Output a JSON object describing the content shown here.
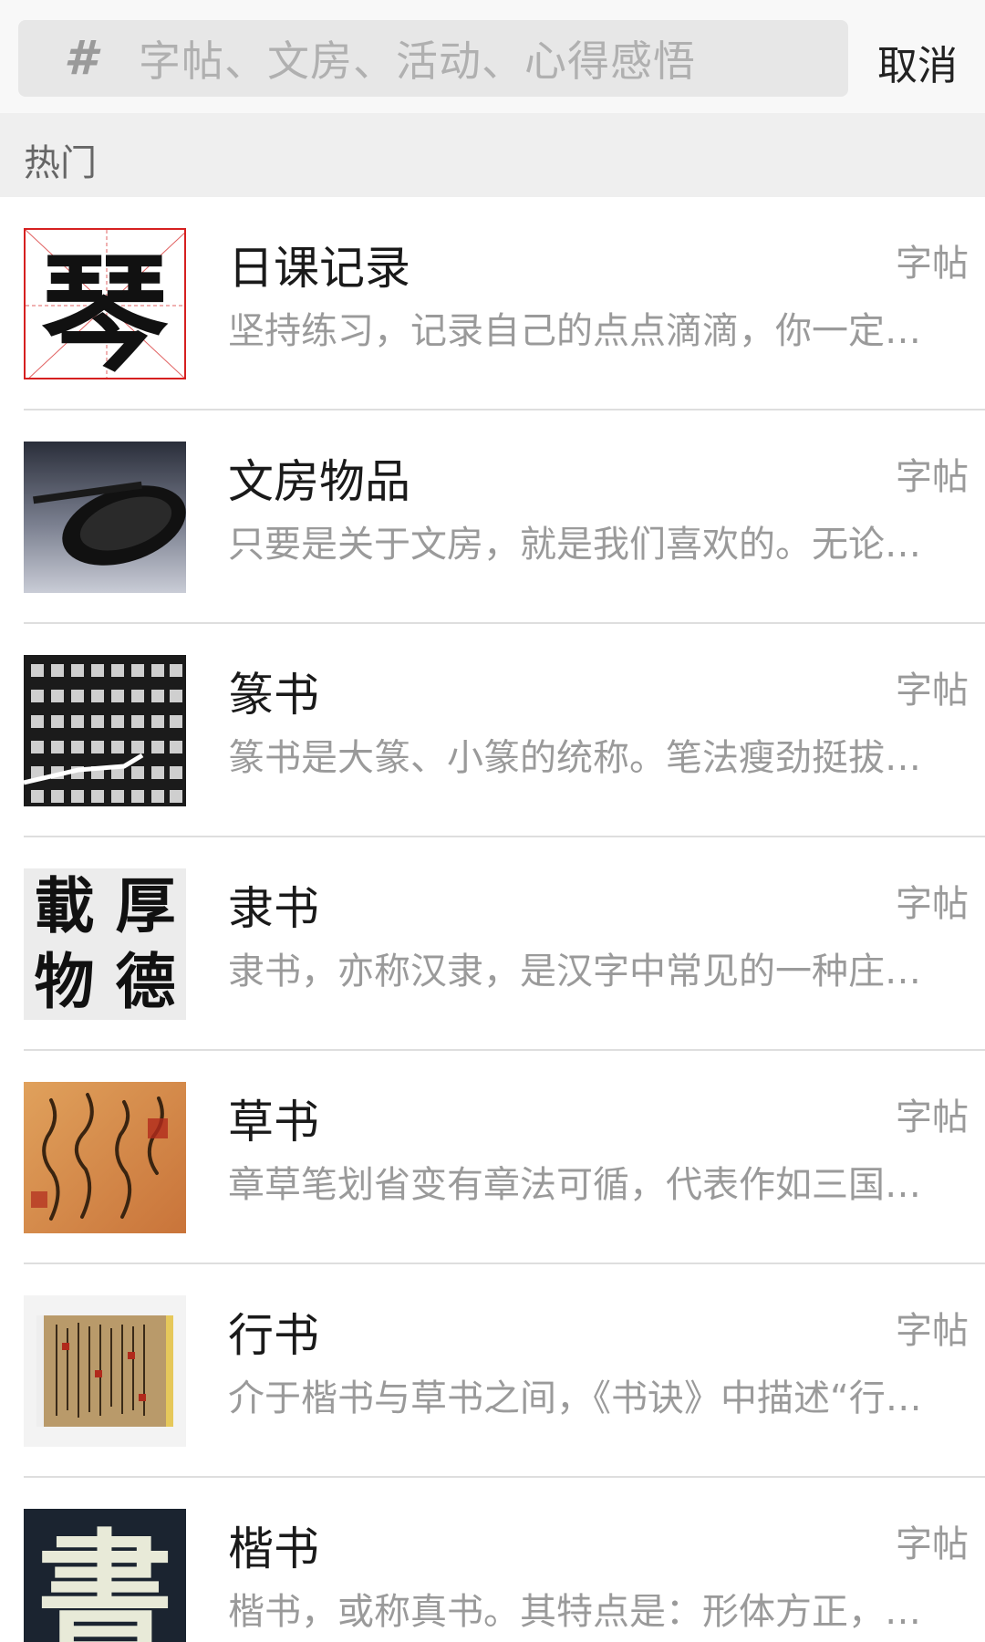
{
  "search": {
    "icon": "hash-icon",
    "icon_glyph": "#",
    "placeholder": "字帖、文房、活动、心得感悟",
    "cancel_label": "取消"
  },
  "section": {
    "title": "热门"
  },
  "items": [
    {
      "title": "日课记录",
      "tag": "字帖",
      "desc": "坚持练习，记录自己的点点滴滴，你一定…",
      "thumb_char": "琴"
    },
    {
      "title": "文房物品",
      "tag": "字帖",
      "desc": "只要是关于文房，就是我们喜欢的。无论…"
    },
    {
      "title": "篆书",
      "tag": "字帖",
      "desc": "篆书是大篆、小篆的统称。笔法瘦劲挺拔…"
    },
    {
      "title": "隶书",
      "tag": "字帖",
      "desc": "隶书，亦称汉隶，是汉字中常见的一种庄…",
      "thumb_chars": [
        "載",
        "厚",
        "物",
        "德"
      ]
    },
    {
      "title": "草书",
      "tag": "字帖",
      "desc": "章草笔划省变有章法可循，代表作如三国…"
    },
    {
      "title": "行书",
      "tag": "字帖",
      "desc": "介于楷书与草书之间，《书诀》中描述“行…"
    },
    {
      "title": "楷书",
      "tag": "字帖",
      "desc": "楷书，或称真书。其特点是：形体方正，…",
      "thumb_char": "書"
    }
  ]
}
